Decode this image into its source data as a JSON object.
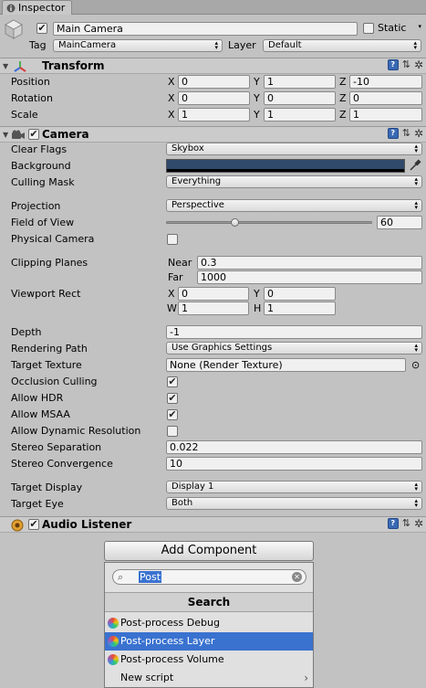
{
  "tab": {
    "label": "Inspector"
  },
  "object": {
    "active": true,
    "name": "Main Camera",
    "static_label": "Static",
    "tag_label": "Tag",
    "tag_value": "MainCamera",
    "layer_label": "Layer",
    "layer_value": "Default"
  },
  "transform": {
    "title": "Transform",
    "rows": [
      {
        "label": "Position",
        "x": "0",
        "y": "1",
        "z": "-10"
      },
      {
        "label": "Rotation",
        "x": "0",
        "y": "0",
        "z": "0"
      },
      {
        "label": "Scale",
        "x": "1",
        "y": "1",
        "z": "1"
      }
    ],
    "axis": {
      "x": "X",
      "y": "Y",
      "z": "Z"
    }
  },
  "camera": {
    "title": "Camera",
    "enabled": true,
    "clear_flags_label": "Clear Flags",
    "clear_flags_value": "Skybox",
    "background_label": "Background",
    "background_color": "#2f4a6b",
    "culling_mask_label": "Culling Mask",
    "culling_mask_value": "Everything",
    "projection_label": "Projection",
    "projection_value": "Perspective",
    "fov_label": "Field of View",
    "fov_value": "60",
    "fov_min": 1,
    "fov_max": 179,
    "physical_label": "Physical Camera",
    "clipping_label": "Clipping Planes",
    "near_label": "Near",
    "near_value": "0.3",
    "far_label": "Far",
    "far_value": "1000",
    "viewport_label": "Viewport Rect",
    "vp_x_label": "X",
    "vp_x": "0",
    "vp_y_label": "Y",
    "vp_y": "0",
    "vp_w_label": "W",
    "vp_w": "1",
    "vp_h_label": "H",
    "vp_h": "1",
    "depth_label": "Depth",
    "depth_value": "-1",
    "rendering_path_label": "Rendering Path",
    "rendering_path_value": "Use Graphics Settings",
    "target_texture_label": "Target Texture",
    "target_texture_value": "None (Render Texture)",
    "occlusion_label": "Occlusion Culling",
    "hdr_label": "Allow HDR",
    "msaa_label": "Allow MSAA",
    "dynres_label": "Allow Dynamic Resolution",
    "stereo_sep_label": "Stereo Separation",
    "stereo_sep_value": "0.022",
    "stereo_conv_label": "Stereo Convergence",
    "stereo_conv_value": "10",
    "target_display_label": "Target Display",
    "target_display_value": "Display 1",
    "target_eye_label": "Target Eye",
    "target_eye_value": "Both",
    "occlusion_checked": true,
    "hdr_checked": true,
    "msaa_checked": true,
    "dynres_checked": false,
    "physical_checked": false
  },
  "audio_listener": {
    "title": "Audio Listener",
    "enabled": true
  },
  "add_component": {
    "button_label": "Add Component",
    "search_text": "Post",
    "results_title": "Search",
    "items": [
      {
        "label": "Post-process Debug"
      },
      {
        "label": "Post-process Layer"
      },
      {
        "label": "Post-process Volume"
      },
      {
        "label": "New script"
      }
    ]
  },
  "icons": {
    "check_glyph": "✔",
    "popup_arrow": "▴▾",
    "fold_glyph": "▼",
    "help": "?",
    "sliders": "⇅",
    "gear": "✲",
    "chevron": "›",
    "search": "⌕",
    "clear": "✕",
    "picker": "⊙"
  }
}
